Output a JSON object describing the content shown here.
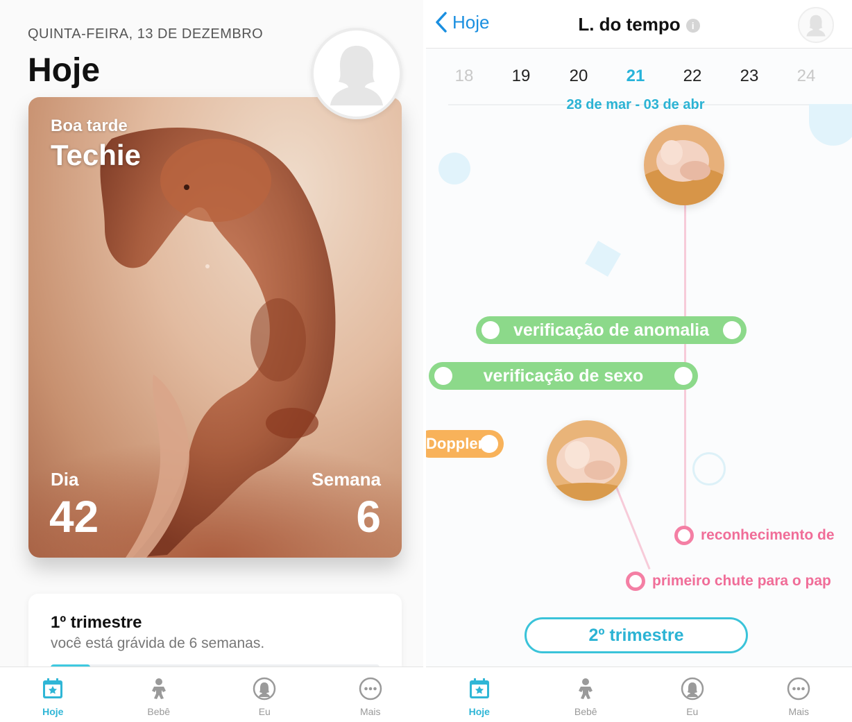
{
  "left": {
    "date": "QUINTA-FEIRA, 13 DE DEZEMBRO",
    "title": "Hoje",
    "hero": {
      "greeting": "Boa tarde",
      "name": "Techie",
      "day_label": "Dia",
      "day_value": "42",
      "week_label": "Semana",
      "week_value": "6"
    },
    "trimester_card": {
      "title": "1º trimestre",
      "subtitle": "você está grávida de 6 semanas.",
      "progress": 0.12
    }
  },
  "right": {
    "nav": {
      "back_label": "Hoje",
      "title": "L. do tempo",
      "info_glyph": "i"
    },
    "weeks": [
      "18",
      "19",
      "20",
      "21",
      "22",
      "23",
      "24"
    ],
    "active_week": "21",
    "range": "28 de mar - 03 de abr",
    "events": {
      "anomaly": "verificação de anomalia",
      "sex": "verificação de sexo",
      "doppler": "Doppler",
      "recognition": "reconhecimento de",
      "first_kick": "primeiro chute para o pap"
    },
    "trimester_button": "2º trimestre"
  },
  "tabs": [
    {
      "label": "Hoje",
      "icon": "calendar-icon"
    },
    {
      "label": "Bebê",
      "icon": "baby-icon"
    },
    {
      "label": "Eu",
      "icon": "profile-icon"
    },
    {
      "label": "Mais",
      "icon": "more-icon"
    }
  ],
  "colors": {
    "accent": "#2bb3d4",
    "green_event": "#8cd98a",
    "pink_event": "#f06d98",
    "orange_event": "#f8b25a",
    "back_link": "#1a8fe0"
  }
}
